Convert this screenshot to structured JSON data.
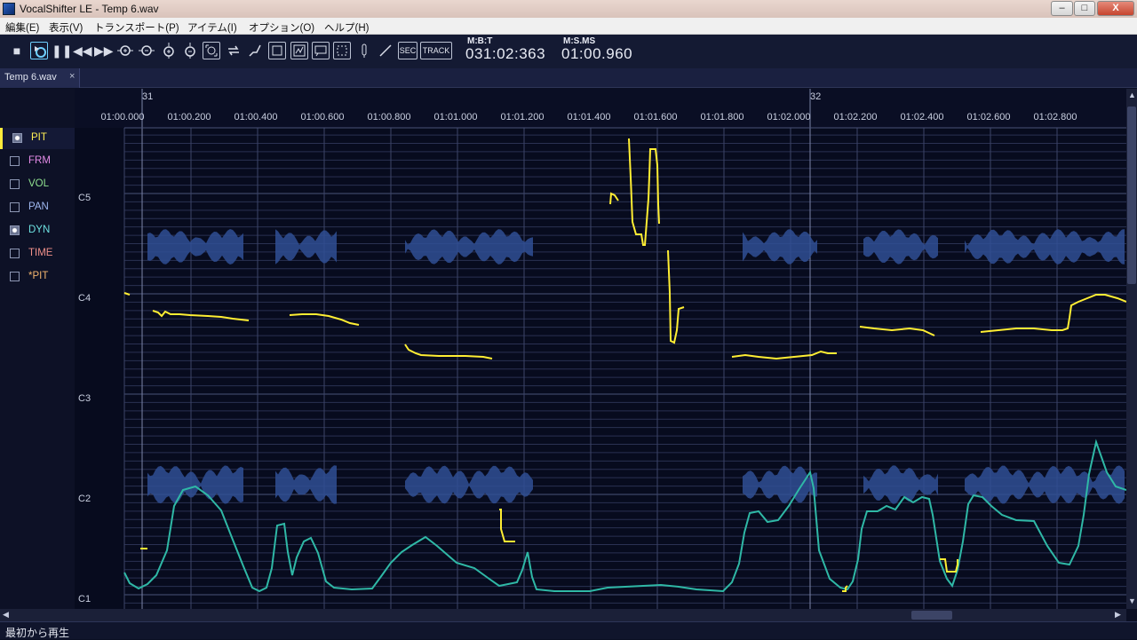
{
  "window": {
    "title": "VocalShifter LE - Temp 6.wav",
    "controls": {
      "minimize": "–",
      "maximize": "□",
      "close": "X"
    }
  },
  "menu": [
    "編集(E)",
    "表示(V)",
    "トランスポート(P)",
    "アイテム(I)",
    "オプション(O)",
    "ヘルプ(H)"
  ],
  "toolbar": {
    "icons": [
      "stop-icon",
      "play-from-start-icon",
      "pause-icon",
      "rewind-icon",
      "fast-forward-icon",
      "zoom-in-h-icon",
      "zoom-out-h-icon",
      "zoom-in-v-icon",
      "zoom-out-v-icon",
      "fit-icon",
      "loop-icon",
      "snap-icon",
      "select-box-icon",
      "select-pitch-icon",
      "select-note-icon",
      "select-region-icon",
      "pen-icon",
      "line-icon"
    ],
    "sec_label": "SEC",
    "track_label": "TRACK",
    "mbt_label": "M:B:T",
    "mbt_value": "031:02:363",
    "msms_label": "M:S.MS",
    "msms_value": "01:00.960"
  },
  "tab": {
    "label": "Temp 6.wav",
    "close": "×"
  },
  "layers": [
    {
      "label": "PIT",
      "color": "#ffee55",
      "checked": true
    },
    {
      "label": "FRM",
      "color": "#e38be6",
      "checked": false
    },
    {
      "label": "VOL",
      "color": "#8fe08f",
      "checked": false
    },
    {
      "label": "PAN",
      "color": "#9fb8f0",
      "checked": false
    },
    {
      "label": "DYN",
      "color": "#6de0e0",
      "checked": true
    },
    {
      "label": "TIME",
      "color": "#f0908a",
      "checked": false
    },
    {
      "label": "*PIT",
      "color": "#f3b56e",
      "checked": false
    }
  ],
  "ruler": {
    "bars": [
      "31",
      "32"
    ],
    "times": [
      "01:00.000",
      "01:00.200",
      "01:00.400",
      "01:00.600",
      "01:00.800",
      "01:01.000",
      "01:01.200",
      "01:01.400",
      "01:01.600",
      "01:01.800",
      "01:02.000",
      "01:02.200",
      "01:02.400",
      "01:02.600",
      "01:02.800"
    ]
  },
  "pitch_labels": [
    "C5",
    "C4",
    "C3",
    "C2",
    "C1"
  ],
  "colors": {
    "pitch": "#ffee33",
    "dynamics": "#2fb8a6",
    "waveform": "#2f4f94"
  },
  "status": "最初から再生"
}
